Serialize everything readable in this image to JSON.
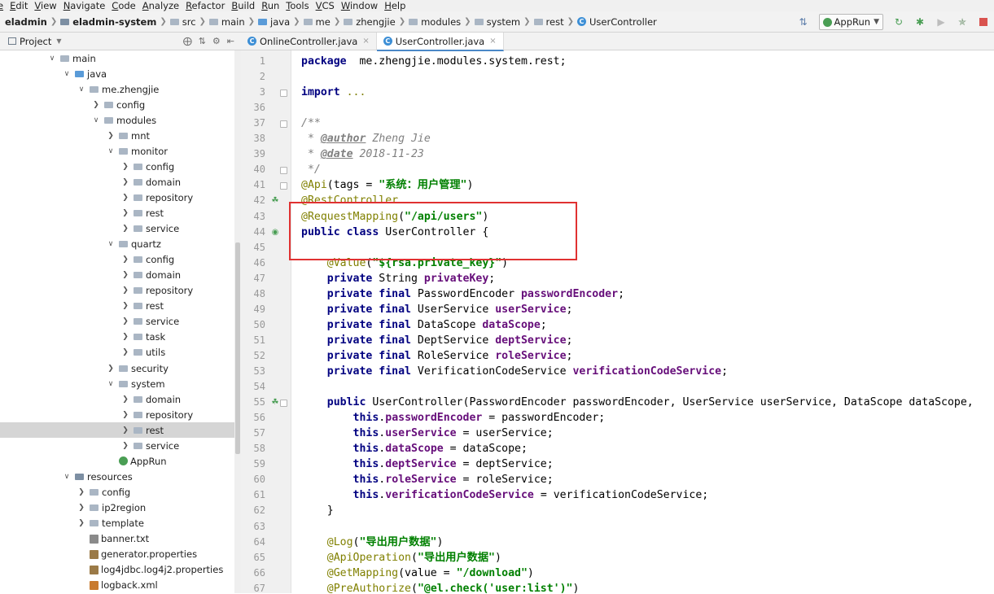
{
  "menu": [
    "e",
    "Edit",
    "View",
    "Navigate",
    "Code",
    "Analyze",
    "Refactor",
    "Build",
    "Run",
    "Tools",
    "VCS",
    "Window",
    "Help"
  ],
  "breadcrumb": [
    {
      "label": "eladmin",
      "bold": true,
      "icon": "none"
    },
    {
      "label": "eladmin-system",
      "bold": true,
      "icon": "module"
    },
    {
      "label": "src",
      "icon": "folder"
    },
    {
      "label": "main",
      "icon": "folder"
    },
    {
      "label": "java",
      "icon": "folder-blue"
    },
    {
      "label": "me",
      "icon": "folder"
    },
    {
      "label": "zhengjie",
      "icon": "folder"
    },
    {
      "label": "modules",
      "icon": "folder"
    },
    {
      "label": "system",
      "icon": "folder"
    },
    {
      "label": "rest",
      "icon": "folder"
    },
    {
      "label": "UserController",
      "icon": "class"
    }
  ],
  "toolbar": {
    "run_config": "AppRun"
  },
  "project_panel": {
    "title": "Project"
  },
  "tabs": [
    {
      "label": "OnlineController.java",
      "active": false
    },
    {
      "label": "UserController.java",
      "active": true
    }
  ],
  "tree": [
    {
      "label": "main",
      "depth": 3,
      "chev": "open",
      "icon": "folder"
    },
    {
      "label": "java",
      "depth": 4,
      "chev": "open",
      "icon": "folder-blue"
    },
    {
      "label": "me.zhengjie",
      "depth": 5,
      "chev": "open",
      "icon": "folder"
    },
    {
      "label": "config",
      "depth": 6,
      "chev": "closed",
      "icon": "folder"
    },
    {
      "label": "modules",
      "depth": 6,
      "chev": "open",
      "icon": "folder"
    },
    {
      "label": "mnt",
      "depth": 7,
      "chev": "closed",
      "icon": "folder"
    },
    {
      "label": "monitor",
      "depth": 7,
      "chev": "open",
      "icon": "folder"
    },
    {
      "label": "config",
      "depth": 8,
      "chev": "closed",
      "icon": "folder"
    },
    {
      "label": "domain",
      "depth": 8,
      "chev": "closed",
      "icon": "folder"
    },
    {
      "label": "repository",
      "depth": 8,
      "chev": "closed",
      "icon": "folder"
    },
    {
      "label": "rest",
      "depth": 8,
      "chev": "closed",
      "icon": "folder"
    },
    {
      "label": "service",
      "depth": 8,
      "chev": "closed",
      "icon": "folder"
    },
    {
      "label": "quartz",
      "depth": 7,
      "chev": "open",
      "icon": "folder"
    },
    {
      "label": "config",
      "depth": 8,
      "chev": "closed",
      "icon": "folder"
    },
    {
      "label": "domain",
      "depth": 8,
      "chev": "closed",
      "icon": "folder"
    },
    {
      "label": "repository",
      "depth": 8,
      "chev": "closed",
      "icon": "folder"
    },
    {
      "label": "rest",
      "depth": 8,
      "chev": "closed",
      "icon": "folder"
    },
    {
      "label": "service",
      "depth": 8,
      "chev": "closed",
      "icon": "folder"
    },
    {
      "label": "task",
      "depth": 8,
      "chev": "closed",
      "icon": "folder"
    },
    {
      "label": "utils",
      "depth": 8,
      "chev": "closed",
      "icon": "folder"
    },
    {
      "label": "security",
      "depth": 7,
      "chev": "closed",
      "icon": "folder"
    },
    {
      "label": "system",
      "depth": 7,
      "chev": "open",
      "icon": "folder"
    },
    {
      "label": "domain",
      "depth": 8,
      "chev": "closed",
      "icon": "folder"
    },
    {
      "label": "repository",
      "depth": 8,
      "chev": "closed",
      "icon": "folder"
    },
    {
      "label": "rest",
      "depth": 8,
      "chev": "closed",
      "icon": "folder",
      "selected": true
    },
    {
      "label": "service",
      "depth": 8,
      "chev": "closed",
      "icon": "folder"
    },
    {
      "label": "AppRun",
      "depth": 7,
      "chev": "none",
      "icon": "app"
    },
    {
      "label": "resources",
      "depth": 4,
      "chev": "open",
      "icon": "folder-res"
    },
    {
      "label": "config",
      "depth": 5,
      "chev": "closed",
      "icon": "folder"
    },
    {
      "label": "ip2region",
      "depth": 5,
      "chev": "closed",
      "icon": "folder"
    },
    {
      "label": "template",
      "depth": 5,
      "chev": "closed",
      "icon": "folder"
    },
    {
      "label": "banner.txt",
      "depth": 5,
      "chev": "none",
      "icon": "file"
    },
    {
      "label": "generator.properties",
      "depth": 5,
      "chev": "none",
      "icon": "prop"
    },
    {
      "label": "log4jdbc.log4j2.properties",
      "depth": 5,
      "chev": "none",
      "icon": "prop"
    },
    {
      "label": "logback.xml",
      "depth": 5,
      "chev": "none",
      "icon": "xml"
    }
  ],
  "code_lines": [
    {
      "n": "1",
      "parts": [
        [
          "kw",
          "package"
        ],
        [
          "",
          "  me.zhengjie.modules.system.rest;"
        ]
      ]
    },
    {
      "n": "2",
      "parts": []
    },
    {
      "n": "3",
      "parts": [
        [
          "kw",
          "import"
        ],
        [
          "",
          " "
        ],
        [
          "an",
          "..."
        ]
      ],
      "fold": true
    },
    {
      "n": "36",
      "parts": []
    },
    {
      "n": "37",
      "parts": [
        [
          "com",
          "/**"
        ]
      ],
      "fold": true
    },
    {
      "n": "38",
      "parts": [
        [
          "com",
          " * "
        ],
        [
          "tag",
          "@author"
        ],
        [
          "com",
          " Zheng Jie"
        ]
      ]
    },
    {
      "n": "39",
      "parts": [
        [
          "com",
          " * "
        ],
        [
          "tag",
          "@date"
        ],
        [
          "com",
          " 2018-11-23"
        ]
      ]
    },
    {
      "n": "40",
      "parts": [
        [
          "com",
          " */"
        ]
      ],
      "fold": true
    },
    {
      "n": "41",
      "parts": [
        [
          "an",
          "@Api"
        ],
        [
          "",
          "(tags = "
        ],
        [
          "str",
          "\"系统：用户管理\""
        ],
        [
          "",
          ")"
        ]
      ],
      "fold": true
    },
    {
      "n": "42",
      "parts": [
        [
          "an",
          "@RestController"
        ]
      ],
      "gicon": "bean"
    },
    {
      "n": "43",
      "parts": [
        [
          "an",
          "@RequestMapping"
        ],
        [
          "",
          "("
        ],
        [
          "str",
          "\"/api/users\""
        ],
        [
          "",
          ")"
        ]
      ]
    },
    {
      "n": "44",
      "parts": [
        [
          "kw",
          "public class"
        ],
        [
          "",
          " UserController {"
        ]
      ],
      "gicon": "class"
    },
    {
      "n": "45",
      "parts": []
    },
    {
      "n": "46",
      "parts": [
        [
          "",
          "    "
        ],
        [
          "an",
          "@Value"
        ],
        [
          "",
          "("
        ],
        [
          "str",
          "\"${rsa.private_key}\""
        ],
        [
          "",
          ")"
        ]
      ]
    },
    {
      "n": "47",
      "parts": [
        [
          "",
          "    "
        ],
        [
          "kw",
          "private"
        ],
        [
          "",
          " String "
        ],
        [
          "fld",
          "privateKey"
        ],
        [
          "",
          ";"
        ]
      ]
    },
    {
      "n": "48",
      "parts": [
        [
          "",
          "    "
        ],
        [
          "kw",
          "private final"
        ],
        [
          "",
          " PasswordEncoder "
        ],
        [
          "fld",
          "passwordEncoder"
        ],
        [
          "",
          ";"
        ]
      ]
    },
    {
      "n": "49",
      "parts": [
        [
          "",
          "    "
        ],
        [
          "kw",
          "private final"
        ],
        [
          "",
          " UserService "
        ],
        [
          "fld",
          "userService"
        ],
        [
          "",
          ";"
        ]
      ]
    },
    {
      "n": "50",
      "parts": [
        [
          "",
          "    "
        ],
        [
          "kw",
          "private final"
        ],
        [
          "",
          " DataScope "
        ],
        [
          "fld",
          "dataScope"
        ],
        [
          "",
          ";"
        ]
      ]
    },
    {
      "n": "51",
      "parts": [
        [
          "",
          "    "
        ],
        [
          "kw",
          "private final"
        ],
        [
          "",
          " DeptService "
        ],
        [
          "fld",
          "deptService"
        ],
        [
          "",
          ";"
        ]
      ]
    },
    {
      "n": "52",
      "parts": [
        [
          "",
          "    "
        ],
        [
          "kw",
          "private final"
        ],
        [
          "",
          " RoleService "
        ],
        [
          "fld",
          "roleService"
        ],
        [
          "",
          ";"
        ]
      ]
    },
    {
      "n": "53",
      "parts": [
        [
          "",
          "    "
        ],
        [
          "kw",
          "private final"
        ],
        [
          "",
          " VerificationCodeService "
        ],
        [
          "fld",
          "verificationCodeService"
        ],
        [
          "",
          ";"
        ]
      ]
    },
    {
      "n": "54",
      "parts": []
    },
    {
      "n": "55",
      "parts": [
        [
          "",
          "    "
        ],
        [
          "kw",
          "public"
        ],
        [
          "",
          " UserController(PasswordEncoder passwordEncoder, UserService userService, DataScope dataScope,"
        ]
      ],
      "gicon": "bean",
      "fold": true
    },
    {
      "n": "56",
      "parts": [
        [
          "",
          "        "
        ],
        [
          "kw",
          "this"
        ],
        [
          "",
          "."
        ],
        [
          "fld",
          "passwordEncoder"
        ],
        [
          "",
          " = passwordEncoder;"
        ]
      ]
    },
    {
      "n": "57",
      "parts": [
        [
          "",
          "        "
        ],
        [
          "kw",
          "this"
        ],
        [
          "",
          "."
        ],
        [
          "fld",
          "userService"
        ],
        [
          "",
          " = userService;"
        ]
      ]
    },
    {
      "n": "58",
      "parts": [
        [
          "",
          "        "
        ],
        [
          "kw",
          "this"
        ],
        [
          "",
          "."
        ],
        [
          "fld",
          "dataScope"
        ],
        [
          "",
          " = dataScope;"
        ]
      ]
    },
    {
      "n": "59",
      "parts": [
        [
          "",
          "        "
        ],
        [
          "kw",
          "this"
        ],
        [
          "",
          "."
        ],
        [
          "fld",
          "deptService"
        ],
        [
          "",
          " = deptService;"
        ]
      ]
    },
    {
      "n": "60",
      "parts": [
        [
          "",
          "        "
        ],
        [
          "kw",
          "this"
        ],
        [
          "",
          "."
        ],
        [
          "fld",
          "roleService"
        ],
        [
          "",
          " = roleService;"
        ]
      ]
    },
    {
      "n": "61",
      "parts": [
        [
          "",
          "        "
        ],
        [
          "kw",
          "this"
        ],
        [
          "",
          "."
        ],
        [
          "fld",
          "verificationCodeService"
        ],
        [
          "",
          " = verificationCodeService;"
        ]
      ]
    },
    {
      "n": "62",
      "parts": [
        [
          "",
          "    }"
        ]
      ]
    },
    {
      "n": "63",
      "parts": []
    },
    {
      "n": "64",
      "parts": [
        [
          "",
          "    "
        ],
        [
          "an",
          "@Log"
        ],
        [
          "",
          "("
        ],
        [
          "str",
          "\"导出用户数据\""
        ],
        [
          "",
          ")"
        ]
      ]
    },
    {
      "n": "65",
      "parts": [
        [
          "",
          "    "
        ],
        [
          "an",
          "@ApiOperation"
        ],
        [
          "",
          "("
        ],
        [
          "str",
          "\"导出用户数据\""
        ],
        [
          "",
          ")"
        ]
      ]
    },
    {
      "n": "66",
      "parts": [
        [
          "",
          "    "
        ],
        [
          "an",
          "@GetMapping"
        ],
        [
          "",
          "(value = "
        ],
        [
          "str",
          "\"/download\""
        ],
        [
          "",
          ")"
        ]
      ]
    },
    {
      "n": "67",
      "parts": [
        [
          "",
          "    "
        ],
        [
          "an",
          "@PreAuthorize"
        ],
        [
          "",
          "("
        ],
        [
          "str",
          "\"@el.check('user:list')\""
        ],
        [
          "",
          ")"
        ]
      ]
    }
  ]
}
